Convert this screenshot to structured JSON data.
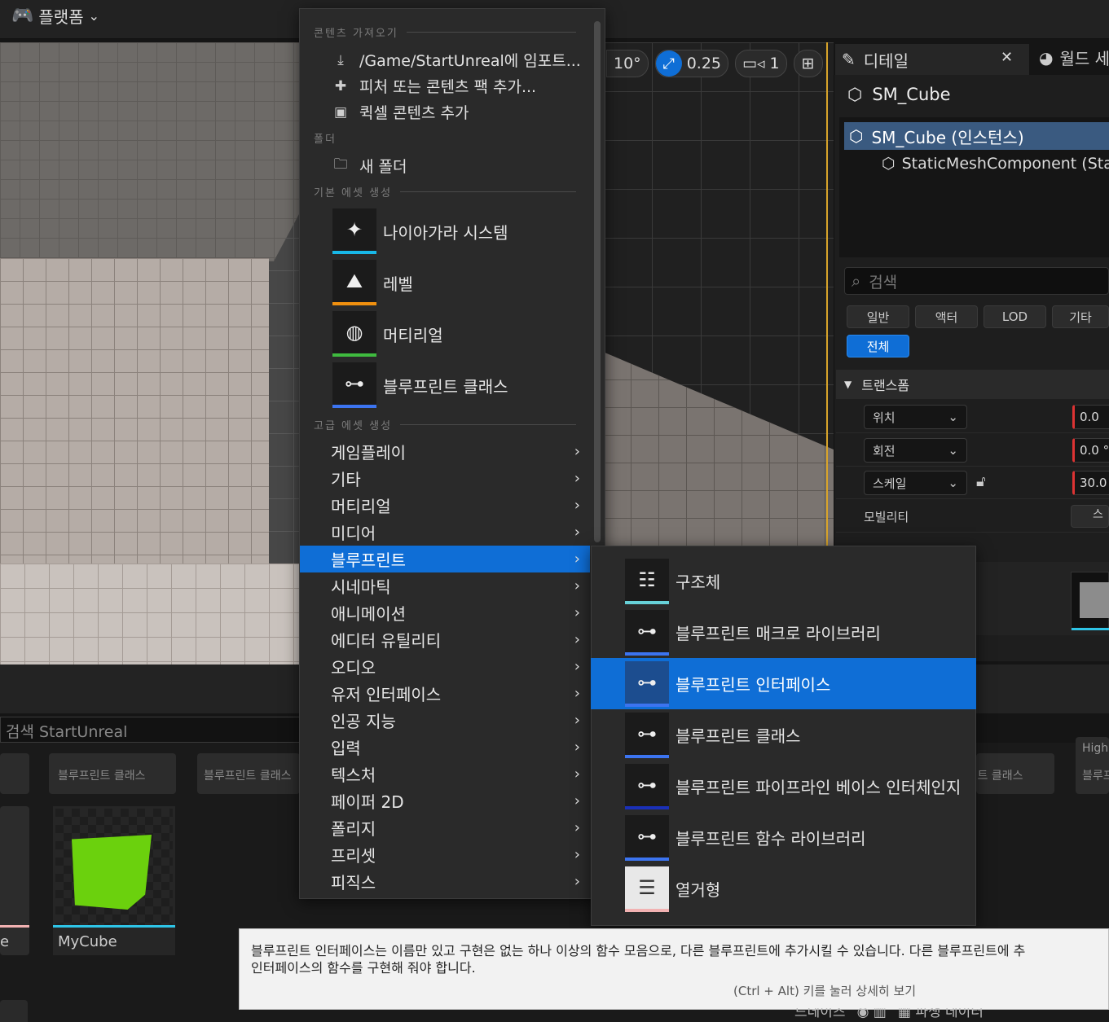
{
  "topbar": {
    "platform_label": "플랫폼"
  },
  "viewport": {
    "toolbar": {
      "angle_snap": "10°",
      "scale_snap": "0.25",
      "camera_speed": "1"
    }
  },
  "content_browser": {
    "search_placeholder": "검색 StartUnreal",
    "tile_label_1": "블루프린트 클래스",
    "tile_label_2": "블루프린트 클래스",
    "tile_label_right": "블루프린트 클래스",
    "tile_label_right2": "블루프",
    "tile_label_far_right_top": "High",
    "left_edge_label": "e",
    "mycube_label": "MyCube",
    "footer_label_1": "드데이즈",
    "footer_label_2": "파생 데이터"
  },
  "context_menu": {
    "sections": {
      "import": "콘텐츠 가져오기",
      "folder": "폴더",
      "basic_assets": "기본 에셋 생성",
      "advanced_assets": "고급 에셋 생성"
    },
    "import_items": [
      {
        "label": "/Game/StartUnreal에 임포트...",
        "icon": "import-icon"
      },
      {
        "label": "피처 또는 콘텐츠 팩 추가...",
        "icon": "feature-pack-icon"
      },
      {
        "label": "퀵셀 콘텐츠 추가",
        "icon": "quixel-icon"
      }
    ],
    "new_folder_label": "새 폴더",
    "basic_items": [
      {
        "label": "나이아가라 시스템",
        "color": "#18b8e8"
      },
      {
        "label": "레벨",
        "color": "#f0900f"
      },
      {
        "label": "머티리얼",
        "color": "#3fbb3f"
      },
      {
        "label": "블루프린트 클래스",
        "color": "#3c74f0"
      }
    ],
    "categories": [
      "게임플레이",
      "기타",
      "머티리얼",
      "미디어",
      "블루프린트",
      "시네마틱",
      "애니메이션",
      "에디터 유틸리티",
      "오디오",
      "유저 인터페이스",
      "인공 지능",
      "입력",
      "텍스처",
      "페이퍼 2D",
      "폴리지",
      "프리셋",
      "피직스"
    ],
    "active_category": "블루프린트"
  },
  "submenu": {
    "items": [
      {
        "label": "구조체",
        "color": "#67d1d8"
      },
      {
        "label": "블루프린트 매크로 라이브러리",
        "color": "#3c74f0"
      },
      {
        "label": "블루프린트 인터페이스",
        "color": "#3c74f0"
      },
      {
        "label": "블루프린트 클래스",
        "color": "#3c74f0"
      },
      {
        "label": "블루프린트 파이프라인 베이스 인터체인지",
        "color": "#1a30b8"
      },
      {
        "label": "블루프린트 함수 라이브러리",
        "color": "#3c74f0"
      },
      {
        "label": "열거형",
        "color": "#f2b2b2"
      }
    ],
    "active_label": "블루프린트 인터페이스"
  },
  "tooltip": {
    "text": "블루프린트 인터페이스는 이름만 있고 구현은 없는 하나 이상의 함수 모음으로, 다른 블루프린트에 추가시킬 수 있습니다. 다른 블루프린트에 추\n인터페이스의 함수를 구현해 줘야 합니다.",
    "hint": "(Ctrl + Alt) 키를 눌러 상세히 보기"
  },
  "details": {
    "tab_label": "디테일",
    "world_tab_label": "월드 세",
    "actor_name": "SM_Cube",
    "tree": {
      "instance_label": "SM_Cube (인스턴스)",
      "component_label": "StaticMeshComponent (Stat"
    },
    "search_placeholder": "검색",
    "filters": [
      "일반",
      "액터",
      "LOD",
      "기타"
    ],
    "filter_all": "전체",
    "section_transform": "트랜스폼",
    "rows": [
      {
        "label": "위치",
        "value": "0.0"
      },
      {
        "label": "회전",
        "value": "0.0 °"
      },
      {
        "label": "스케일",
        "value": "30.0"
      }
    ],
    "mobility_label": "모빌리티",
    "mobility_value": "스"
  },
  "colors": {
    "accent": "#0f6ed6",
    "selection": "#d7a32a"
  }
}
